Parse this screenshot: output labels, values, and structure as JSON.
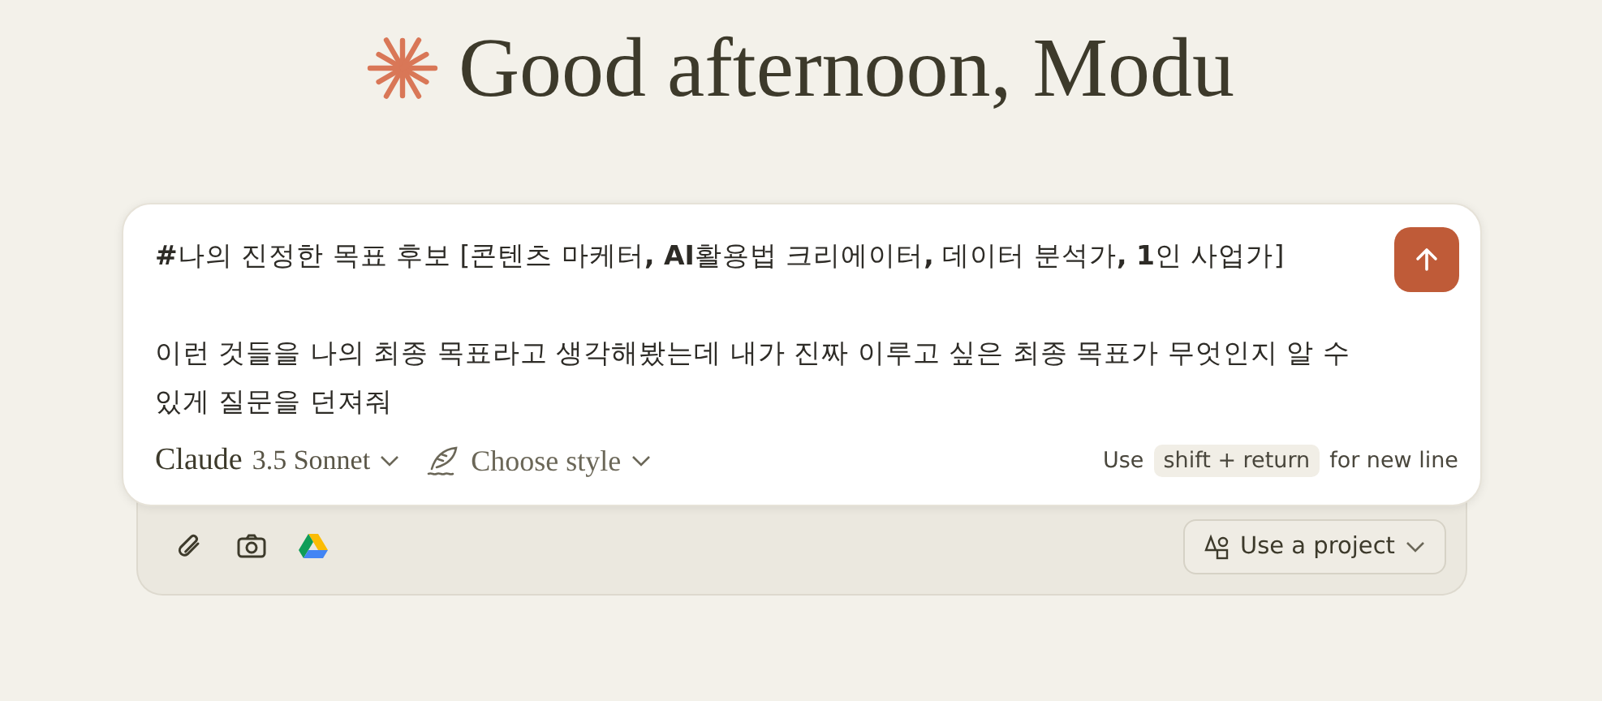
{
  "greeting": "Good afternoon, Modu",
  "composer": {
    "paragraphs": [
      "**#**나의 진정한 목표 후보 [콘텐츠 마케터**, AI**활용법 크리에이터**,** 데이터 분석가**, 1**인 사업가]",
      "이런 것들을 나의 최종 목표라고 생각해봤는데 내가 진짜 이루고 싶은 최종 목표가 무엇인지 알 수 있게 질문을 던져줘"
    ],
    "model": {
      "brand": "Claude",
      "version": "3.5 Sonnet"
    },
    "style_button": "Choose style",
    "hint": {
      "before": "Use",
      "key": "shift + return",
      "after": "for new line"
    }
  },
  "tray": {
    "tools": [
      {
        "kind": "attach"
      },
      {
        "kind": "camera"
      },
      {
        "kind": "drive"
      }
    ],
    "project_button": "Use a project"
  }
}
